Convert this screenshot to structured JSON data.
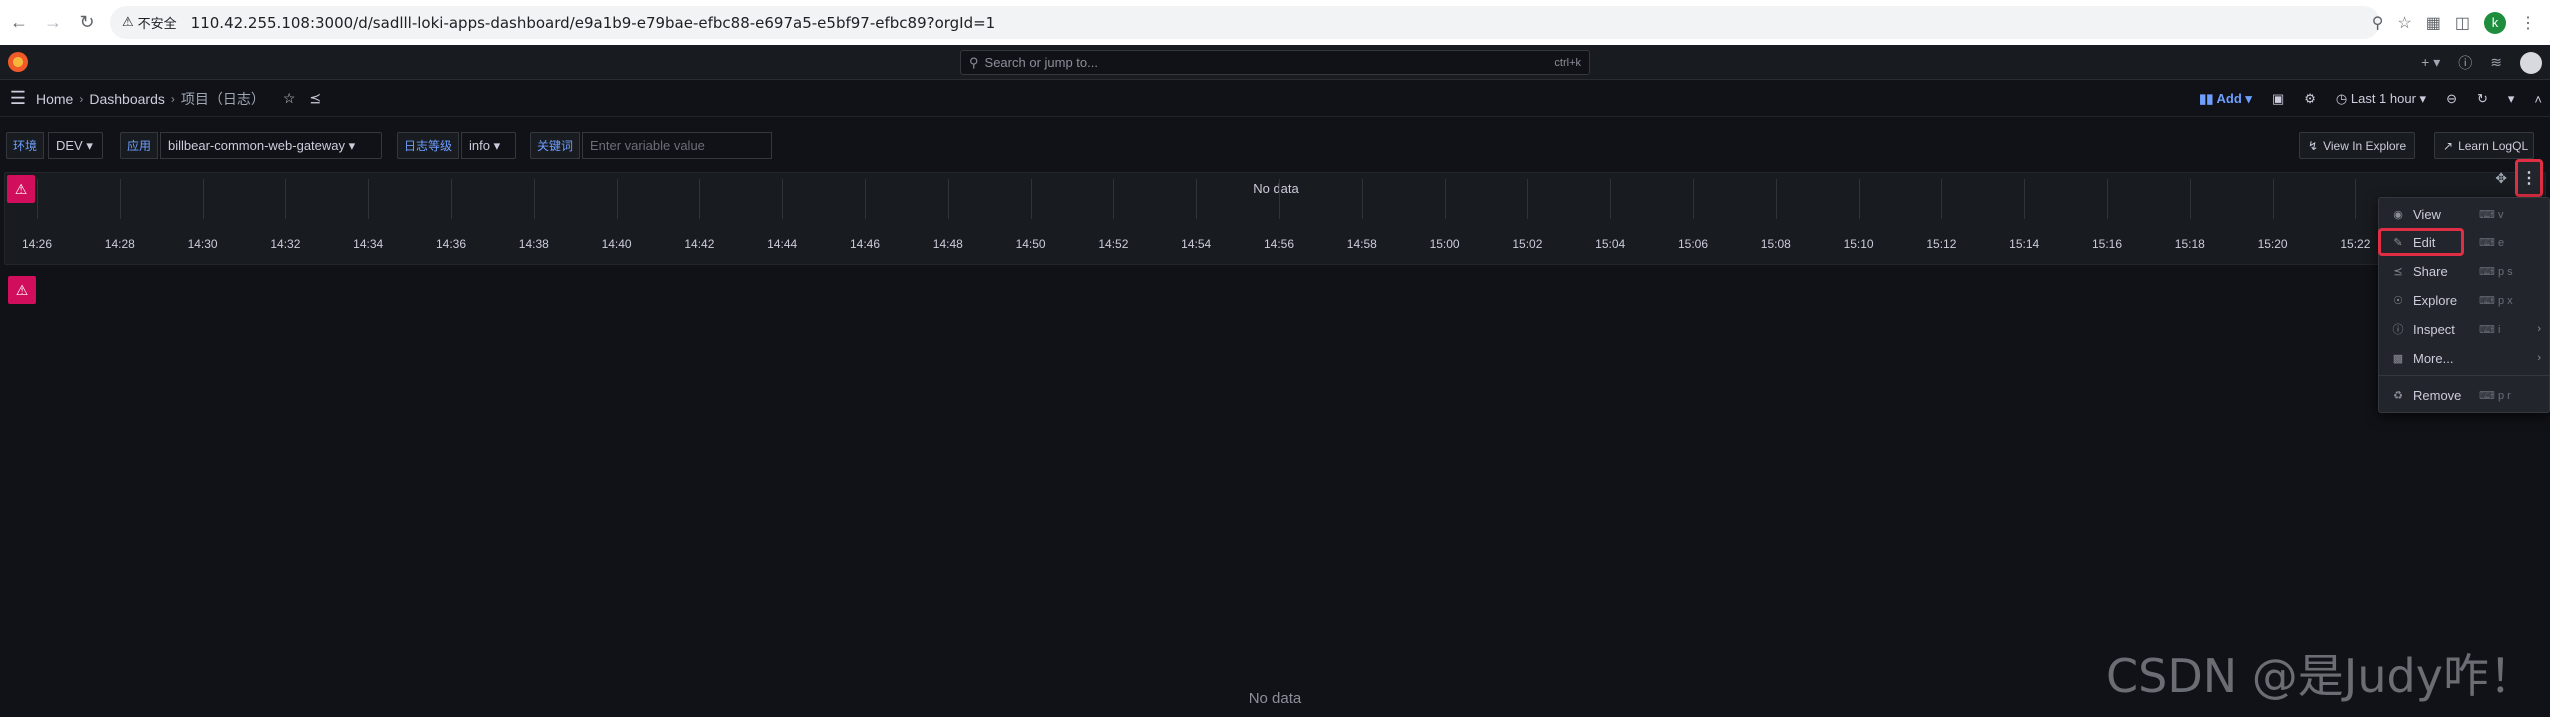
{
  "browser": {
    "insecure_label": "不安全",
    "url": "110.42.255.108:3000/d/sadlll-loki-apps-dashboard/e9a1b9-e79bae-efbc88-e697a5-e5bf97-efbc89?orgId=1",
    "profile_initial": "k"
  },
  "topbar": {
    "search_placeholder": "Search or jump to...",
    "search_shortcut": "ctrl+k",
    "plus": "+"
  },
  "breadcrumb": {
    "home": "Home",
    "dashboards": "Dashboards",
    "current": "项目（日志）"
  },
  "toolbar": {
    "add_label": "Add",
    "time_range": "Last 1 hour"
  },
  "variables": [
    {
      "label": "环境",
      "value": "DEV"
    },
    {
      "label": "应用",
      "value": "billbear-common-web-gateway"
    },
    {
      "label": "日志等级",
      "value": "info"
    },
    {
      "label": "关键词",
      "placeholder": "Enter variable value"
    }
  ],
  "links": {
    "view_in_explore": "View In Explore",
    "learn_logql": "Learn LogQL"
  },
  "panel": {
    "no_data": "No data",
    "ticks": [
      "14:26",
      "14:28",
      "14:30",
      "14:32",
      "14:34",
      "14:36",
      "14:38",
      "14:40",
      "14:42",
      "14:44",
      "14:46",
      "14:48",
      "14:50",
      "14:52",
      "14:54",
      "14:56",
      "14:58",
      "15:00",
      "15:02",
      "15:04",
      "15:06",
      "15:08",
      "15:10",
      "15:12",
      "15:14",
      "15:16",
      "15:18",
      "15:20",
      "15:22"
    ]
  },
  "menu": {
    "items": [
      {
        "label": "View",
        "shortcut": "v",
        "icon": "eye-icon"
      },
      {
        "label": "Edit",
        "shortcut": "e",
        "icon": "edit-icon"
      },
      {
        "label": "Share",
        "shortcut": "p s",
        "icon": "share-icon"
      },
      {
        "label": "Explore",
        "shortcut": "p x",
        "icon": "compass-icon"
      },
      {
        "label": "Inspect",
        "shortcut": "i",
        "icon": "info-icon"
      },
      {
        "label": "More...",
        "shortcut": "",
        "icon": "cube-icon"
      },
      {
        "label": "Remove",
        "shortcut": "p r",
        "icon": "trash-icon"
      }
    ]
  },
  "bottom_no_data": "No data",
  "watermark": "CSDN @是Judy咋！"
}
